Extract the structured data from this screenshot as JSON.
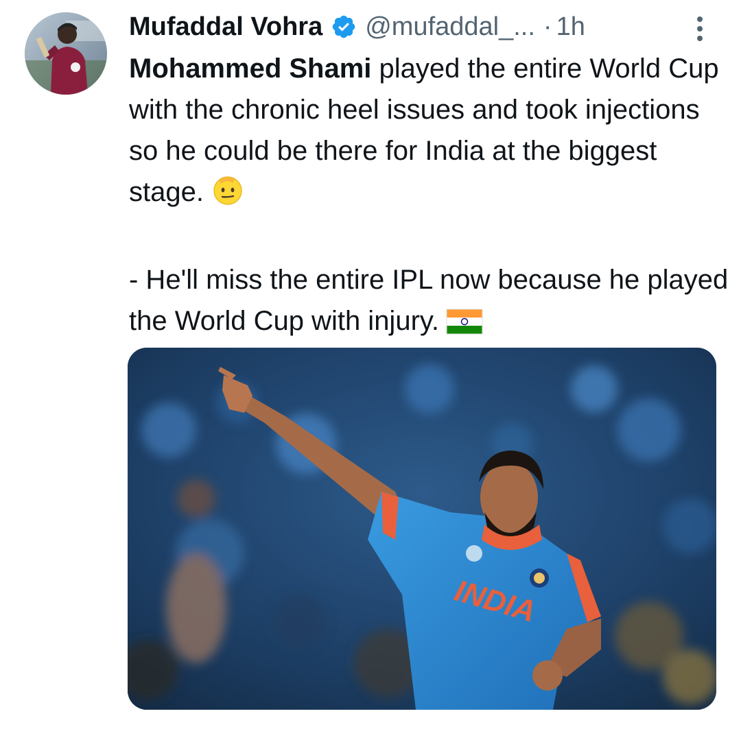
{
  "tweet": {
    "author": {
      "display_name": "Mufaddal Vohra",
      "handle": "@mufaddal_...",
      "verified": true,
      "avatar_icon": "avatar"
    },
    "separator": "·",
    "time": "1h",
    "text": {
      "bold_name": "Mohammed Shami",
      "line1_rest": " played the entire World Cup with the chronic heel issues and took injections so he could be there for India at the biggest stage.",
      "line2": "- He'll miss the entire IPL now because he played the World Cup with injury."
    },
    "emojis": [
      "saluting-face-emoji",
      "india-flag-emoji"
    ],
    "media": {
      "jersey_text": "INDIA"
    },
    "colors": {
      "verified_blue": "#1d9bf0",
      "text": "#0f1419",
      "secondary": "#536471"
    }
  }
}
